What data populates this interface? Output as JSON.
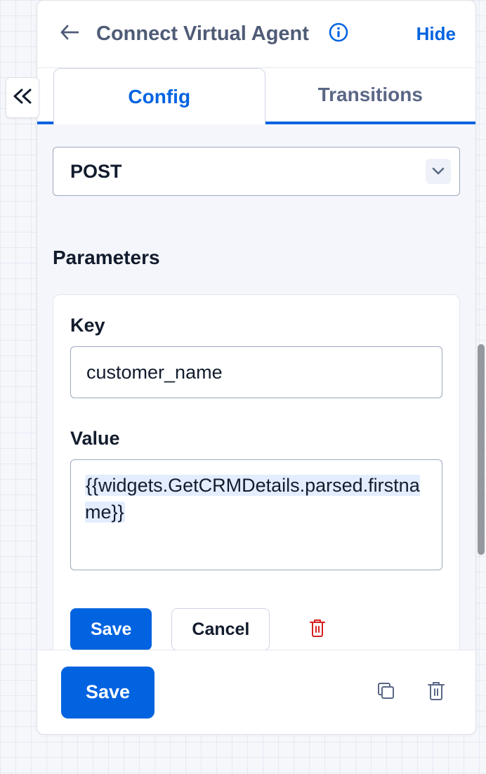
{
  "header": {
    "title": "Connect Virtual Agent",
    "hide_label": "Hide"
  },
  "tabs": {
    "config": "Config",
    "transitions": "Transitions"
  },
  "method": {
    "value": "POST"
  },
  "sections": {
    "parameters": "Parameters"
  },
  "param": {
    "key_label": "Key",
    "key_value": "customer_name",
    "value_label": "Value",
    "value_value": "{{widgets.GetCRMDetails.parsed.firstname}}"
  },
  "buttons": {
    "save": "Save",
    "cancel": "Cancel",
    "footer_save": "Save"
  },
  "icons": {
    "back": "back-arrow-icon",
    "info": "info-icon",
    "collapse": "collapse-left-icon",
    "chevron_down": "chevron-down-icon",
    "trash": "trash-icon",
    "copy": "copy-icon",
    "footer_trash": "trash-icon"
  }
}
